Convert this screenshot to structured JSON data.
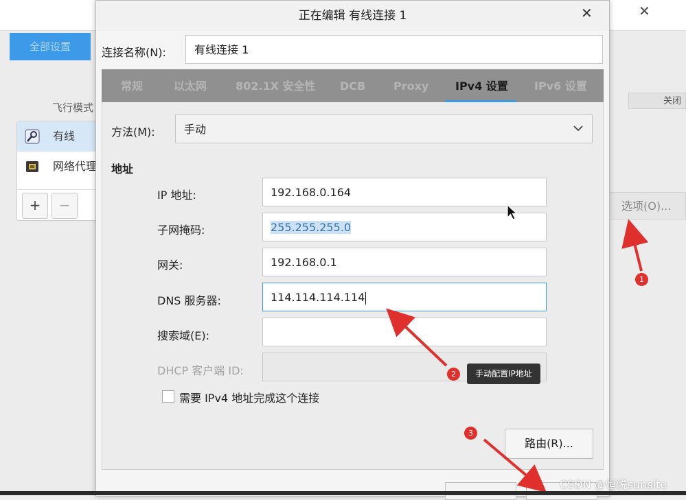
{
  "background": {
    "all_settings_label": "全部设置",
    "airplane_label": "飞行模式",
    "off_label": "关闭",
    "connections": [
      {
        "label": "有线",
        "icon": "wired-network-icon"
      },
      {
        "label": "网络代理",
        "icon": "network-proxy-icon"
      }
    ],
    "add_label": "+",
    "remove_label": "−",
    "options_label": "选项(O)..."
  },
  "dialog": {
    "title": "正在编辑 有线连接 1",
    "close_label": "✕",
    "conn_name_label": "连接名称(N):",
    "conn_name_value": "有线连接 1",
    "tabs": [
      {
        "label": "常规"
      },
      {
        "label": "以太网"
      },
      {
        "label": "802.1X 安全性"
      },
      {
        "label": "DCB"
      },
      {
        "label": "Proxy"
      },
      {
        "label": "IPv4 设置"
      },
      {
        "label": "IPv6 设置"
      }
    ],
    "active_tab": "IPv4 设置",
    "method_label": "方法(M):",
    "method_value": "手动",
    "address_header": "地址",
    "fields": {
      "ip_label": "IP 地址:",
      "ip_value": "192.168.0.164",
      "netmask_label": "子网掩码:",
      "netmask_value": "255.255.255.0",
      "gateway_label": "网关:",
      "gateway_value": "192.168.0.1",
      "dns_label": "DNS 服务器:",
      "dns_value": "114.114.114.114",
      "search_label": "搜索域(E):",
      "search_value": "",
      "dhcp_label": "DHCP 客户端 ID:",
      "dhcp_value": ""
    },
    "require_label": "需要 IPv4 地址完成这个连接",
    "routes_label": "路由(R)..."
  },
  "annotations": {
    "marker_1": "1",
    "marker_2": "2",
    "marker_3": "3",
    "tooltip": "手动配置IP地址",
    "arrow_color": "#e0302d"
  },
  "watermark": "CSDN @恒悦sunsite",
  "colors": {
    "accent": "#3d9ae8",
    "annotation_red": "#e0302d"
  }
}
